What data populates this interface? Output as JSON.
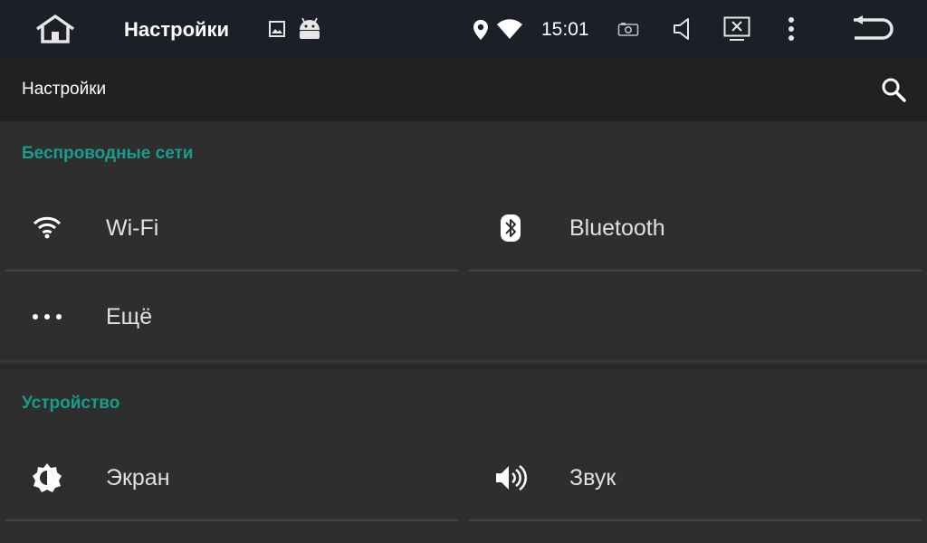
{
  "statusbar": {
    "title": "Настройки",
    "time": "15:01"
  },
  "actionbar": {
    "title": "Настройки"
  },
  "sections": [
    {
      "header": "Беспроводные сети",
      "tiles": [
        {
          "label": "Wi-Fi",
          "icon": "wifi-icon"
        },
        {
          "label": "Bluetooth",
          "icon": "bluetooth-icon"
        },
        {
          "label": "Ещё",
          "icon": "more-icon"
        }
      ]
    },
    {
      "header": "Устройство",
      "tiles": [
        {
          "label": "Экран",
          "icon": "brightness-icon"
        },
        {
          "label": "Звук",
          "icon": "volume-icon"
        }
      ]
    }
  ],
  "colors": {
    "accent": "#1a9c8c",
    "statusbar_bg": "#1c1f27",
    "actionbar_bg": "#212121",
    "content_bg": "#2e2e2e"
  }
}
